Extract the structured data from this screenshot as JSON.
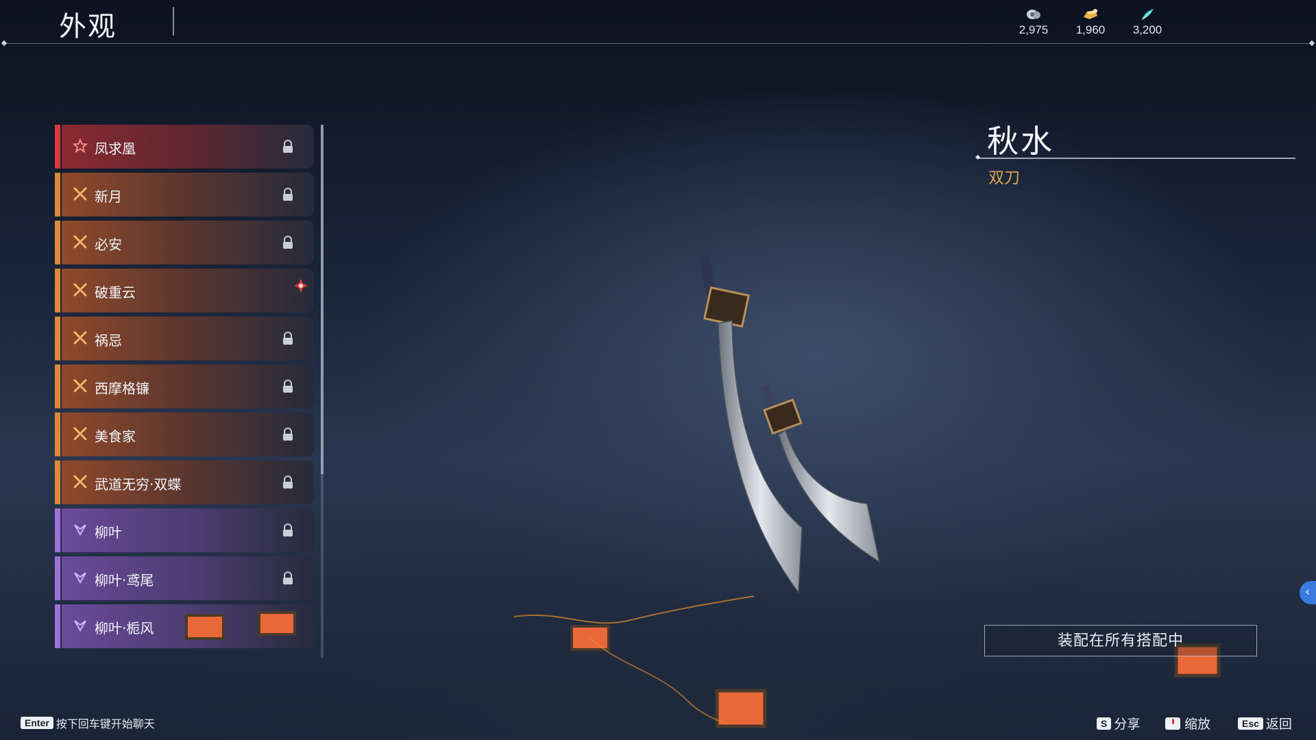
{
  "header": {
    "title": "外观",
    "currencies": [
      {
        "icon": "coin-cloud-icon",
        "value": "2,975"
      },
      {
        "icon": "gold-ingot-icon",
        "value": "1,960"
      },
      {
        "icon": "jade-feather-icon",
        "value": "3,200"
      }
    ]
  },
  "skins": [
    {
      "label": "凤求凰",
      "rarity": "red",
      "icon": "star-emblem-icon",
      "locked": true
    },
    {
      "label": "新月",
      "rarity": "orange",
      "icon": "cross-emblem-icon",
      "locked": true
    },
    {
      "label": "必安",
      "rarity": "orange",
      "icon": "cross-emblem-icon",
      "locked": true
    },
    {
      "label": "破重云",
      "rarity": "orange",
      "icon": "cross-emblem-icon",
      "locked": false,
      "equipped": true
    },
    {
      "label": "祸忌",
      "rarity": "orange",
      "icon": "cross-emblem-icon",
      "locked": true
    },
    {
      "label": "西摩格镰",
      "rarity": "orange",
      "icon": "cross-emblem-icon",
      "locked": true
    },
    {
      "label": "美食家",
      "rarity": "orange",
      "icon": "cross-emblem-icon",
      "locked": true
    },
    {
      "label": "武道无穷·双蝶",
      "rarity": "orange",
      "icon": "cross-emblem-icon",
      "locked": true
    },
    {
      "label": "柳叶",
      "rarity": "purple",
      "icon": "leaf-emblem-icon",
      "locked": true
    },
    {
      "label": "柳叶·鸢尾",
      "rarity": "purple",
      "icon": "leaf-emblem-icon",
      "locked": true
    },
    {
      "label": "柳叶·栀风",
      "rarity": "purple",
      "icon": "leaf-emblem-icon",
      "locked": true
    }
  ],
  "detail": {
    "name": "秋水",
    "type": "双刀",
    "equip_all_label": "装配在所有搭配中"
  },
  "footer": {
    "chat_key": "Enter",
    "chat_hint": "按下回车键开始聊天",
    "share_key": "S",
    "share_label": "分享",
    "zoom_label": "缩放",
    "back_key": "Esc",
    "back_label": "返回"
  },
  "colors": {
    "red": "#d83a3a",
    "orange": "#d98a3a",
    "purple": "#a070d8",
    "accent_gold": "#e0a24c",
    "side_tab_blue": "#3b7be0"
  }
}
